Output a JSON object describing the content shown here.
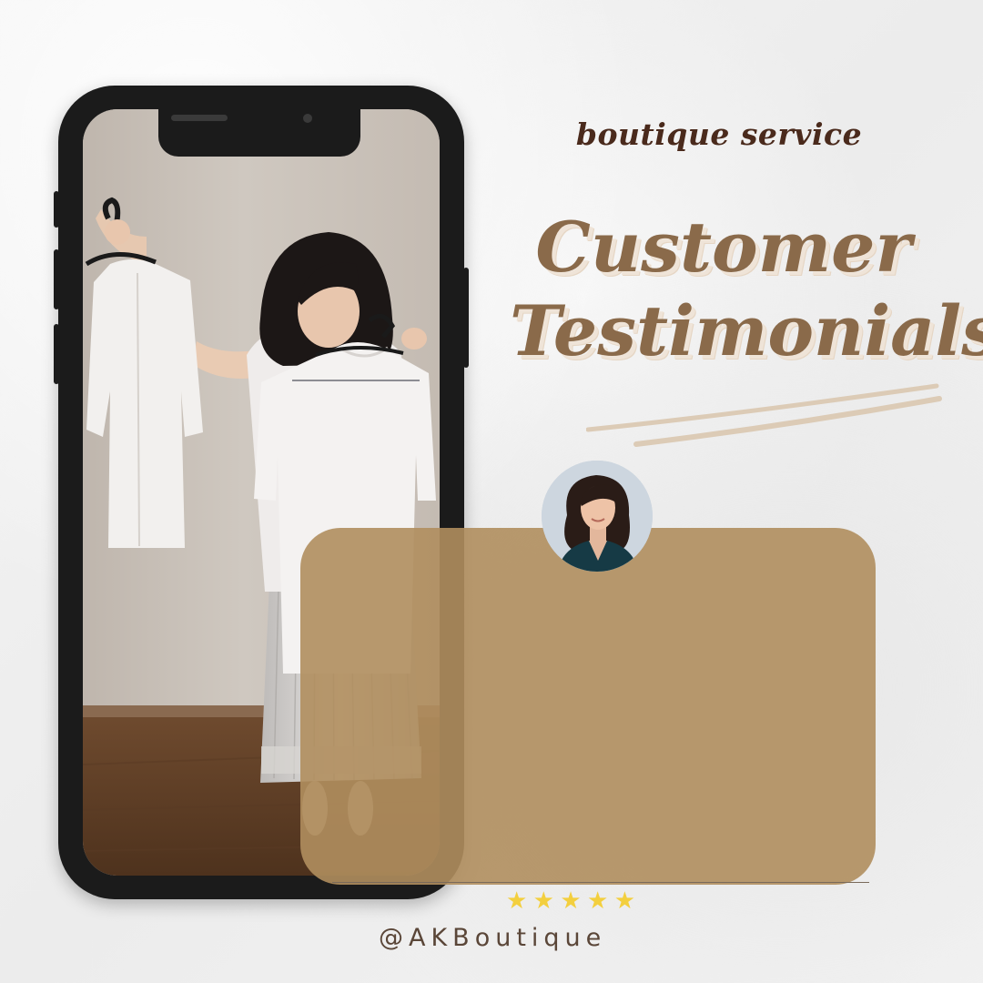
{
  "heading": {
    "subtitle": "boutique service",
    "title_line1": "Customer",
    "title_line2": "Testimonials"
  },
  "rating": {
    "stars": [
      "★",
      "★",
      "★",
      "★",
      "★"
    ],
    "value": 5,
    "max": 5,
    "color": "#f3cf3e"
  },
  "footer": {
    "handle": "@AKBoutique"
  },
  "phone_photo": {
    "icon": "woman-holding-white-shirts-photo"
  },
  "avatar": {
    "icon": "customer-portrait-photo"
  },
  "colors": {
    "background": "#f1f1f1",
    "card": "#b08e5e",
    "subtitle": "#4a2a1c",
    "title": "#8a6a4a",
    "underline": "#d8c9b6",
    "phone_frame": "#1b1b1b"
  }
}
